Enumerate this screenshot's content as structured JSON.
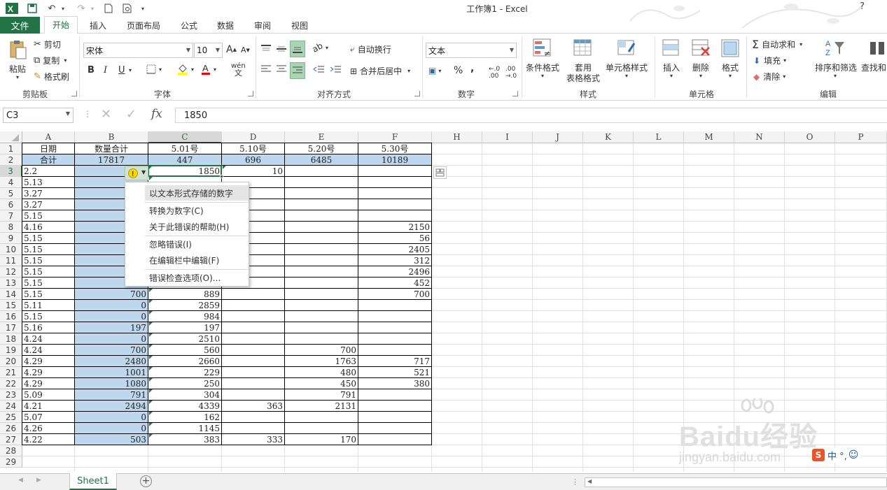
{
  "titlebar": {
    "title": "工作簿1 - Excel",
    "help": "?"
  },
  "tabs": {
    "file": "文件",
    "items": [
      "开始",
      "插入",
      "页面布局",
      "公式",
      "数据",
      "审阅",
      "视图"
    ],
    "active_index": 0
  },
  "ribbon": {
    "clipboard": {
      "paste": "粘贴",
      "cut": "剪切",
      "copy": "复制",
      "format_painter": "格式刷",
      "group": "剪贴板"
    },
    "font": {
      "name": "宋体",
      "size": "10",
      "grow": "A",
      "shrink": "A",
      "bold": "B",
      "italic": "I",
      "underline": "U",
      "phonetic": "wén",
      "group": "字体"
    },
    "alignment": {
      "wrap": "自动换行",
      "merge": "合并后居中",
      "group": "对齐方式"
    },
    "number": {
      "format": "文本",
      "percent": "%",
      "comma": ",",
      "group": "数字"
    },
    "styles": {
      "conditional": "条件格式",
      "table": "套用",
      "table2": "表格格式",
      "cell_styles": "单元格样式",
      "group": "样式"
    },
    "cells": {
      "insert": "插入",
      "delete": "删除",
      "format": "格式",
      "group": "单元格"
    },
    "editing": {
      "autosum": "自动求和",
      "fill": "填充",
      "clear": "清除",
      "sort": "排序和筛选",
      "find": "查找和",
      "group": "编辑"
    }
  },
  "formula_bar": {
    "name_box": "C3",
    "fx": "fx",
    "value": "1850"
  },
  "columns": [
    "A",
    "B",
    "C",
    "D",
    "E",
    "F",
    "H",
    "I",
    "J",
    "K",
    "L",
    "M",
    "N",
    "O",
    "P"
  ],
  "rows": [
    "1",
    "2",
    "3",
    "4",
    "5",
    "6",
    "7",
    "8",
    "9",
    "10",
    "11",
    "12",
    "13",
    "14",
    "15",
    "16",
    "17",
    "18",
    "19",
    "20",
    "21",
    "22",
    "23",
    "24",
    "25",
    "26",
    "27",
    "28",
    "29"
  ],
  "header_row": [
    "日期",
    "数量合计",
    "5.01号",
    "5.10号",
    "5.20号",
    "5.30号"
  ],
  "total_row": [
    "合计",
    "17817",
    "447",
    "696",
    "6485",
    "10189"
  ],
  "data_rows": [
    [
      "2.2",
      "",
      "1850",
      "10",
      "",
      ""
    ],
    [
      "5.13",
      "",
      "",
      "",
      "",
      ""
    ],
    [
      "3.27",
      "",
      "",
      "",
      "",
      ""
    ],
    [
      "3.27",
      "",
      "",
      "",
      "",
      ""
    ],
    [
      "5.15",
      "",
      "",
      "",
      "",
      ""
    ],
    [
      "4.16",
      "",
      "",
      "",
      "",
      "2150"
    ],
    [
      "5.15",
      "",
      "",
      "",
      "",
      "56"
    ],
    [
      "5.15",
      "",
      "",
      "",
      "",
      "2405"
    ],
    [
      "5.15",
      "",
      "",
      "",
      "",
      "312"
    ],
    [
      "5.15",
      "",
      "",
      "",
      "",
      "2496"
    ],
    [
      "5.15",
      "",
      "",
      "",
      "",
      "452"
    ],
    [
      "5.15",
      "700",
      "889",
      "",
      "",
      "700"
    ],
    [
      "5.11",
      "0",
      "2859",
      "",
      "",
      ""
    ],
    [
      "5.15",
      "0",
      "984",
      "",
      "",
      ""
    ],
    [
      "5.16",
      "197",
      "197",
      "",
      "",
      ""
    ],
    [
      "4.24",
      "0",
      "2510",
      "",
      "",
      ""
    ],
    [
      "4.24",
      "700",
      "560",
      "",
      "700",
      ""
    ],
    [
      "4.29",
      "2480",
      "2660",
      "",
      "1763",
      "717"
    ],
    [
      "4.29",
      "1001",
      "229",
      "",
      "480",
      "521"
    ],
    [
      "4.29",
      "1080",
      "250",
      "",
      "450",
      "380"
    ],
    [
      "5.09",
      "791",
      "304",
      "",
      "791",
      ""
    ],
    [
      "4.21",
      "2494",
      "4339",
      "363",
      "2131",
      ""
    ],
    [
      "5.07",
      "0",
      "162",
      "",
      "",
      ""
    ],
    [
      "4.26",
      "0",
      "1145",
      "",
      "",
      ""
    ],
    [
      "4.22",
      "503",
      "383",
      "333",
      "170",
      ""
    ]
  ],
  "error_menu": {
    "items": [
      "以文本形式存储的数字",
      "转换为数字(C)",
      "关于此错误的帮助(H)",
      "忽略错误(I)",
      "在编辑栏中编辑(F)",
      "错误检查选项(O)..."
    ]
  },
  "sheet_tab": "Sheet1",
  "watermark": {
    "brand": "Baidu经验",
    "url": "jingyan.baidu.com",
    "ime": "中 °,"
  },
  "colors": {
    "excel_green": "#217346",
    "selection_blue": "#bdd7ee",
    "error_yellow": "#f5d800"
  }
}
